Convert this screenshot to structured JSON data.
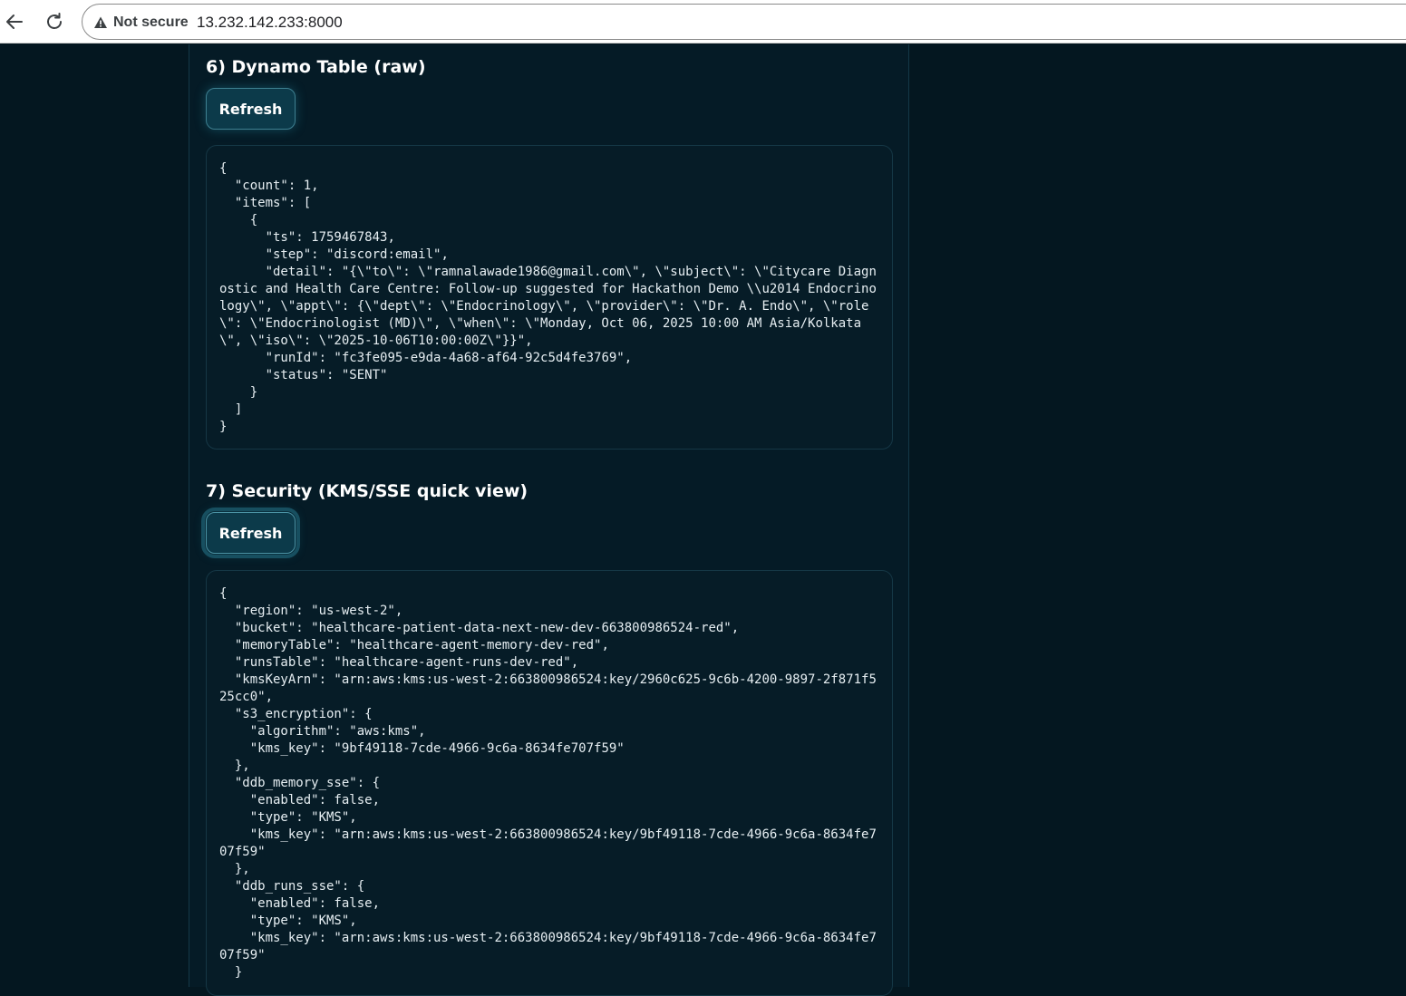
{
  "browser": {
    "security_label": "Not secure",
    "url": "13.232.142.233:8000"
  },
  "dynamo": {
    "title": "6) Dynamo Table (raw)",
    "refresh_label": "Refresh",
    "raw_json": "{\n  \"count\": 1,\n  \"items\": [\n    {\n      \"ts\": 1759467843,\n      \"step\": \"discord:email\",\n      \"detail\": \"{\\\"to\\\": \\\"ramnalawade1986@gmail.com\\\", \\\"subject\\\": \\\"Citycare Diagnostic and Health Care Centre: Follow-up suggested for Hackathon Demo \\\\u2014 Endocrinology\\\", \\\"appt\\\": {\\\"dept\\\": \\\"Endocrinology\\\", \\\"provider\\\": \\\"Dr. A. Endo\\\", \\\"role\\\": \\\"Endocrinologist (MD)\\\", \\\"when\\\": \\\"Monday, Oct 06, 2025 10:00 AM Asia/Kolkata\\\", \\\"iso\\\": \\\"2025-10-06T10:00:00Z\\\"}}\",\n      \"runId\": \"fc3fe095-e9da-4a68-af64-92c5d4fe3769\",\n      \"status\": \"SENT\"\n    }\n  ]\n}"
  },
  "security": {
    "title": "7) Security (KMS/SSE quick view)",
    "refresh_label": "Refresh",
    "raw_json": "{\n  \"region\": \"us-west-2\",\n  \"bucket\": \"healthcare-patient-data-next-new-dev-663800986524-red\",\n  \"memoryTable\": \"healthcare-agent-memory-dev-red\",\n  \"runsTable\": \"healthcare-agent-runs-dev-red\",\n  \"kmsKeyArn\": \"arn:aws:kms:us-west-2:663800986524:key/2960c625-9c6b-4200-9897-2f871f525cc0\",\n  \"s3_encryption\": {\n    \"algorithm\": \"aws:kms\",\n    \"kms_key\": \"9bf49118-7cde-4966-9c6a-8634fe707f59\"\n  },\n  \"ddb_memory_sse\": {\n    \"enabled\": false,\n    \"type\": \"KMS\",\n    \"kms_key\": \"arn:aws:kms:us-west-2:663800986524:key/9bf49118-7cde-4966-9c6a-8634fe707f59\"\n  },\n  \"ddb_runs_sse\": {\n    \"enabled\": false,\n    \"type\": \"KMS\",\n    \"kms_key\": \"arn:aws:kms:us-west-2:663800986524:key/9bf49118-7cde-4966-9c6a-8634fe707f59\"\n  }"
  }
}
